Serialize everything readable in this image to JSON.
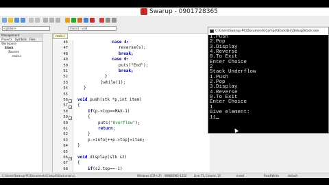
{
  "window": {
    "title": "Swarup - 0901728365"
  },
  "toolbar": {
    "scope_combo": "<global>",
    "function_combo": "main() : void"
  },
  "management": {
    "header": "Management",
    "tabs": [
      "Projects",
      "Symbols",
      "Files"
    ],
    "tree": [
      "Workspace",
      "Stack",
      "Sources",
      "main.c"
    ]
  },
  "editor": {
    "file_tab": "main.c",
    "line_numbers": [
      "46",
      "47",
      "48",
      "49",
      "50",
      "51",
      "52",
      "53",
      "54",
      "55",
      "56",
      "57",
      "58",
      "59",
      "60",
      "61",
      "62",
      "63",
      "64",
      "65",
      "66",
      "67",
      "68"
    ],
    "lines": {
      "l46": "case 4:",
      "l47": "reverse(s);",
      "l48": "break;",
      "l49": "case 0:",
      "l50": "puts(\"End\");",
      "l51": "break;",
      "l52": "}",
      "l53": "}while(1);",
      "l54": "}",
      "l56_kw": "void",
      "l56": " push(stk *p,int item)",
      "l57": "{",
      "l58_kw": "if",
      "l58": "(p->top==MAX-1)",
      "l59": "{",
      "l60": "puts(",
      "l60_str": "\"Overflow\"",
      "l60_end": ");",
      "l61_kw": "return",
      "l61": ";",
      "l62": "}",
      "l63": "p->info[++p->top]=item;",
      "l64": "}",
      "l66_kw": "void",
      "l66": " display(stk s2)",
      "l67": "{",
      "l68_kw": "if",
      "l68": "(s2.top==-1)"
    }
  },
  "console": {
    "title": "C:\\Users\\Swarup-PC\\Documents\\Compil\\Stack\\bin\\Debug\\Stack.exe",
    "lines": [
      "1.Push",
      "2.Pop",
      "3.Display",
      "4.Reverse",
      "0.To Exit",
      "Enter Choice",
      "2",
      "Stack Underflow",
      "1.Push",
      "2.Pop",
      "3.Display",
      "4.Reverse",
      "0.To Exit",
      "Enter Choice",
      "1",
      "Give element:",
      "11"
    ]
  },
  "statusbar": {
    "path": "C:\\Users\\Swarup-PC\\Documents\\Compil\\Stack\\main.c",
    "lang": "Windows (CR+LF)",
    "encoding": "WINDOWS-1252",
    "position": "Line 71, Column 13",
    "mode": "Insert",
    "rw": "Read/Write",
    "profile": "default"
  }
}
